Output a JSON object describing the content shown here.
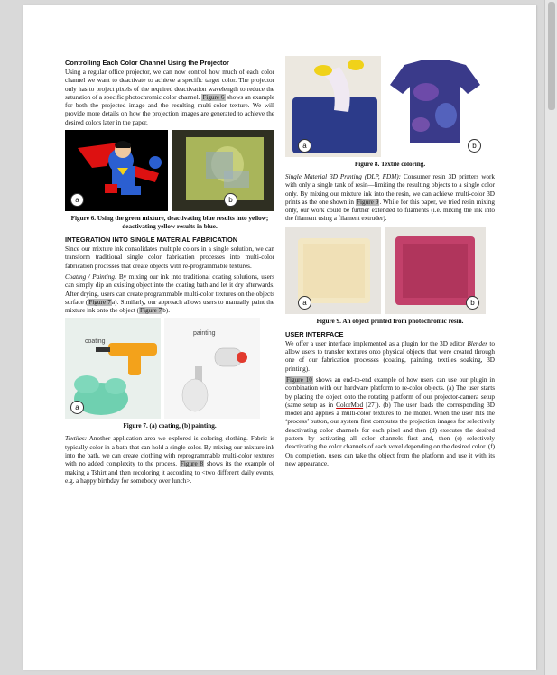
{
  "left": {
    "heading1": "Controlling Each Color Channel Using the Projector",
    "para1": "Using a regular office projector, we can now control how much of each color channel we want to deactivate to achieve a specific target color. The projector only has to project pixels of the required deactivation wavelength to reduce the saturation of a specific photochromic color channel.",
    "para1_ref": "Figure 6",
    "para1_rest": " shows an example for both the projected image and the resulting multi-color texture. We will provide more details on how the projection images are generated to achieve the desired colors later in the paper.",
    "fig6_caption": "Figure 6. Using the green mixture, deactivating blue results into yellow; deactivating yellow results in blue.",
    "heading2": "INTEGRATION INTO SINGLE MATERIAL FABRICATION",
    "para2": "Since our mixture ink consolidates multiple colors in a single solution, we can transform traditional single color fabrication processes into multi-color fabrication processes that create objects with re-programmable textures.",
    "para3_lead": "Coating / Painting:",
    "para3": " By mixing our ink into traditional coating solutions, users can simply dip an existing object into the coating bath and let it dry afterwards. After drying, users can create programmable multi-color textures on the objects surface (",
    "para3_ref1": "Figure 7",
    "para3_mid": "a). Similarly, our approach allows users to manually paint the mixture ink onto the object (",
    "para3_ref2": "Figure 7",
    "para3_end": "b).",
    "fig7_label_coating": "coating",
    "fig7_label_painting": "painting",
    "fig7_caption": "Figure 7. (a) coating, (b) painting.",
    "para4_lead": "Textiles:",
    "para4": " Another application area we explored is coloring clothing. Fabric is typically color in a bath that can hold a single color. By mixing our mixture ink into the bath, we can create clothing with reprogrammable multi-color textures with no added complexity to the process.",
    "para4_ref": "Figure 8",
    "para4_rest1": " shows its the example of making a ",
    "para4_tshirt": "Tshirt",
    "para4_rest2": " and then recoloring it according to <two different daily events, e.g. a happy birthday for somebody over lunch>."
  },
  "right": {
    "fig8_caption": "Figure 8. Textile coloring.",
    "para1_lead": "Single Material 3D Printing (DLP, FDM):",
    "para1": " Consumer resin 3D printers work with only a single tank of resin—limiting the resulting objects to a single color only. By mixing our mixture ink into the resin, we can achieve multi-color 3D prints as the one shown in ",
    "para1_ref": "Figure 9",
    "para1_rest": ". While for this paper, we tried resin mixing only, our work could be further extended to filaments (i.e. mixing the ink into the filament using a filament extruder).",
    "fig9_caption": "Figure 9. An object printed from photochromic resin.",
    "heading": "USER INTERFACE",
    "para2_a": "We offer a user interface implemented as a plugin for the 3D editor ",
    "para2_italic": "Blender",
    "para2_b": " to allow users to transfer textures onto physical objects that were created through one of our fabrication processes (coating, painting, textiles soaking, 3D printing).",
    "para3_ref": "Figure 10",
    "para3_a": " shows an end-to-end example of how users can use our plugin in combination with our hardware platform to re-color objects. (a) The user starts by placing the object onto the rotating platform of our projector-camera setup (same setup as in ",
    "para3_link": "ColorMod",
    "para3_b": " [27]). (b) The user loads the corresponding 3D model and applies a multi-color textures to the model. When the user hits the ‘process’ button, our system first computes the projection images for selectively deactivating color channels for each pixel and then (d) executes the desired pattern by activating all color channels first and, then (e) selectively deactivating the color channels of each voxel depending on the desired color. (f) On completion, users can take the object from the platform and use it with its new appearance."
  },
  "badges": {
    "a": "a",
    "b": "b"
  }
}
